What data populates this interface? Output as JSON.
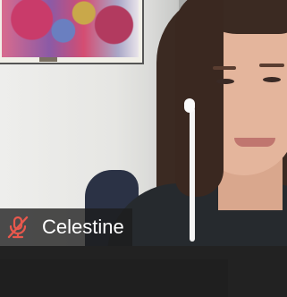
{
  "participant_tile": {
    "name": "Celestine",
    "mic_icon": "mic-muted-icon",
    "mic_icon_color": "#e8584d"
  }
}
